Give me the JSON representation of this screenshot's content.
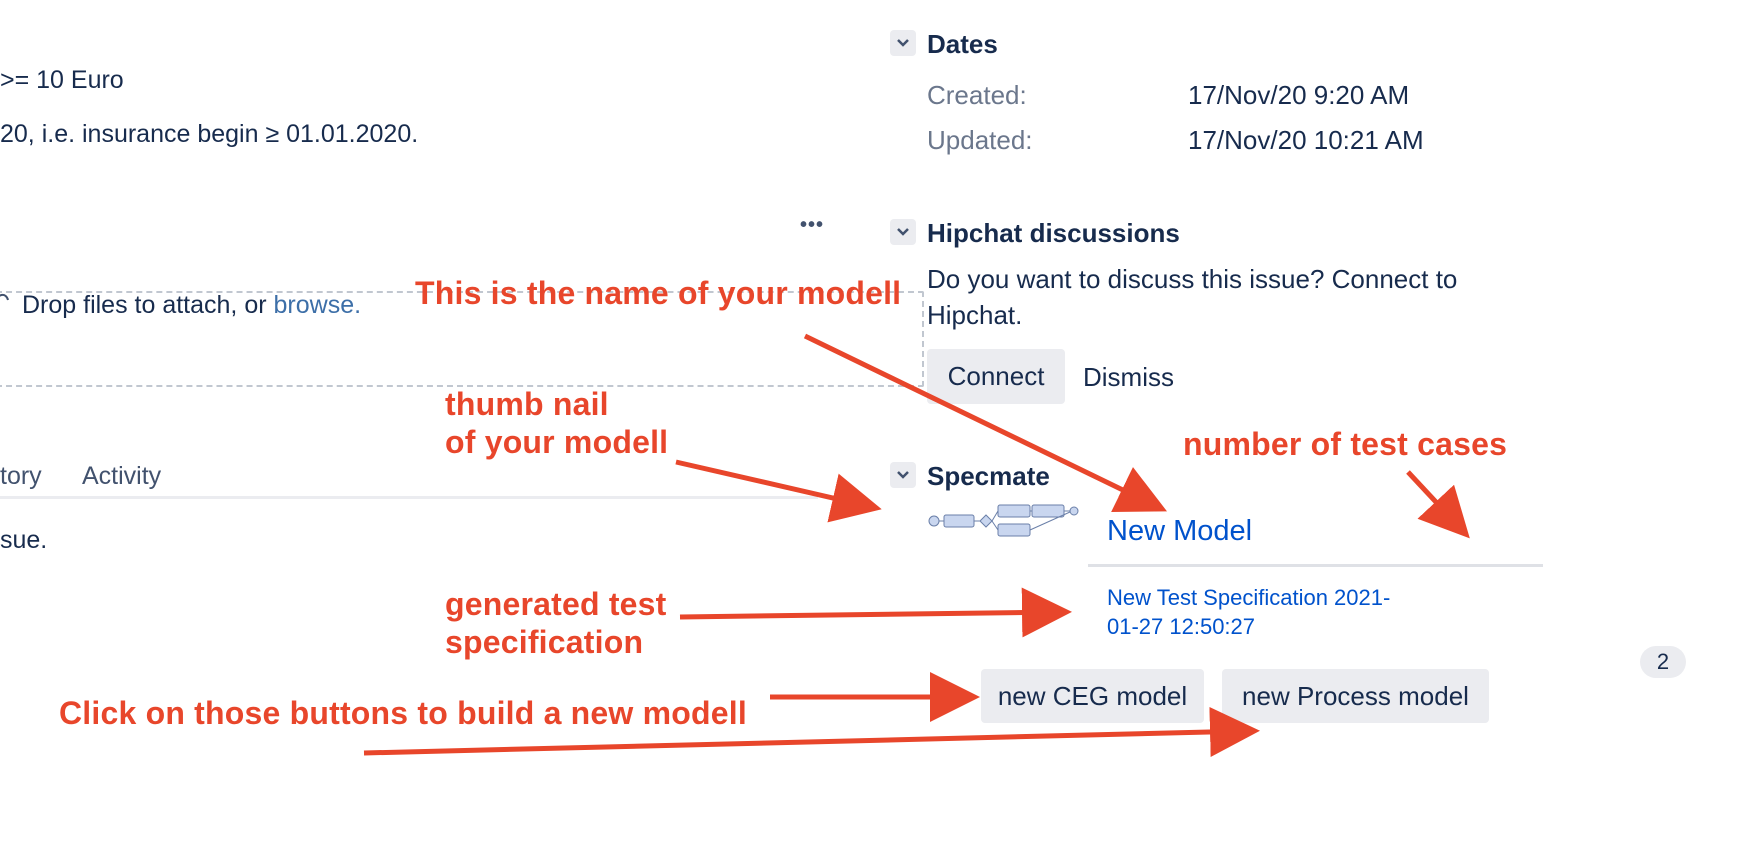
{
  "issue_text": {
    "line1": ">= 10 Euro",
    "line2": "20, i.e. insurance begin ≥ 01.01.2020.",
    "more_actions": "•••"
  },
  "attachments": {
    "drop_text": "Drop files to attach, or ",
    "browse_link": "browse."
  },
  "activity_tabs": {
    "history": "tory",
    "activity": "Activity",
    "body_text": "sue."
  },
  "dates": {
    "title": "Dates",
    "created_label": "Created:",
    "created_value": "17/Nov/20 9:20 AM",
    "updated_label": "Updated:",
    "updated_value": "17/Nov/20 10:21 AM"
  },
  "hipchat": {
    "title": "Hipchat discussions",
    "message_line1": "Do you want to discuss this issue? Connect to",
    "message_line2": "Hipchat.",
    "connect_label": "Connect",
    "dismiss_label": "Dismiss"
  },
  "specmate": {
    "title": "Specmate",
    "model_name": "New Model",
    "test_spec_line1": "New Test Specification 2021-",
    "test_spec_line2": "01-27 12:50:27",
    "test_case_count": "2",
    "new_ceg_button": "new CEG model",
    "new_process_button": "new Process model"
  },
  "annotations": {
    "model_name": "This is the name of your modell",
    "thumbnail_line1": "thumb nail",
    "thumbnail_line2": "of your modell",
    "test_cases": "number of test cases",
    "generated_line1": "generated test",
    "generated_line2": "specification",
    "buttons": "Click on those buttons to build a new modell"
  },
  "colors": {
    "annotation": "#e8462b",
    "link": "#0052cc",
    "text": "#172b4d",
    "muted": "#6b778c",
    "button_bg": "#ebecf0"
  },
  "icons": {
    "chevron": "chevron-down-icon",
    "attach": "cloud-upload-icon",
    "more": "more-icon",
    "thumbnail": "model-thumbnail-icon"
  }
}
